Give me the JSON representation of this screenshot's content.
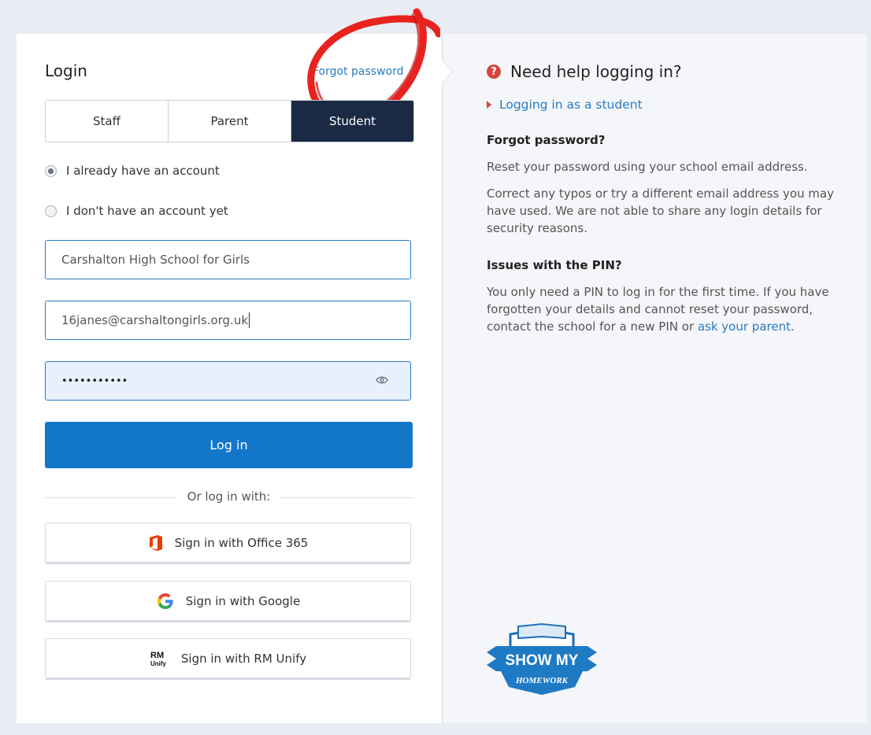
{
  "login": {
    "title": "Login",
    "forgot_link": "Forgot password"
  },
  "tabs": [
    {
      "label": "Staff",
      "active": false
    },
    {
      "label": "Parent",
      "active": false
    },
    {
      "label": "Student",
      "active": true
    }
  ],
  "radios": [
    {
      "label": "I already have an account",
      "checked": true
    },
    {
      "label": "I don't have an account yet",
      "checked": false
    }
  ],
  "fields": {
    "school": "Carshalton High School for Girls",
    "email": "16janes@carshaltongirls.org.uk",
    "password_mask": "•••••••••••"
  },
  "login_button": "Log in",
  "divider_text": "Or log in with:",
  "sso": [
    {
      "label": "Sign in with Office 365",
      "icon": "office365-icon"
    },
    {
      "label": "Sign in with Google",
      "icon": "google-icon"
    },
    {
      "label": "Sign in with RM Unify",
      "icon": "rm-unify-icon"
    }
  ],
  "help": {
    "heading": "Need help logging in?",
    "link": "Logging in as a student",
    "forgot_heading": "Forgot password?",
    "forgot_p1": "Reset your password using your school email address.",
    "forgot_p2": "Correct any typos or try a different email address you may have used. We are not able to share any login details for security reasons.",
    "pin_heading": "Issues with the PIN?",
    "pin_p_before": "You only need a PIN to log in for the first time. If you have forgotten your details and cannot reset your password, contact the school for a new PIN or ",
    "pin_p_link": "ask your parent",
    "pin_p_after": "."
  },
  "logo": {
    "line1": "SHOW MY",
    "line2": "HOMEWORK"
  },
  "colors": {
    "primary": "#1277c9",
    "active_tab": "#1b2a44",
    "accent_red": "#d9433a",
    "link": "#2a7bc1"
  }
}
